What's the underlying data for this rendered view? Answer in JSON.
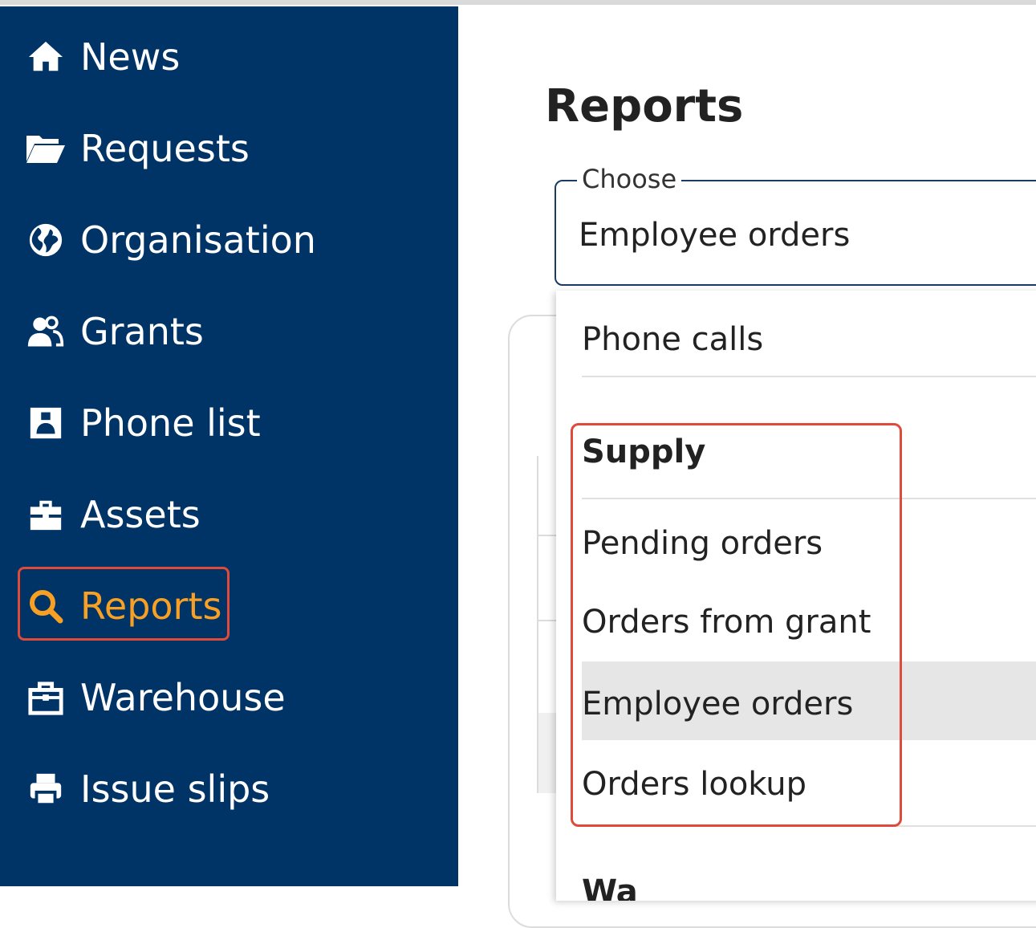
{
  "sidebar": {
    "items": [
      {
        "label": "News",
        "icon": "home-icon"
      },
      {
        "label": "Requests",
        "icon": "folder-open-icon"
      },
      {
        "label": "Organisation",
        "icon": "globe-icon"
      },
      {
        "label": "Grants",
        "icon": "users-icon"
      },
      {
        "label": "Phone list",
        "icon": "contact-card-icon"
      },
      {
        "label": "Assets",
        "icon": "briefcase-icon"
      },
      {
        "label": "Reports",
        "icon": "search-icon",
        "active": true
      },
      {
        "label": "Warehouse",
        "icon": "warehouse-icon"
      },
      {
        "label": "Issue slips",
        "icon": "printer-icon"
      }
    ],
    "background": "#003366",
    "active_color": "#f7a024"
  },
  "main": {
    "title": "Reports",
    "select": {
      "legend": "Choose",
      "value": "Employee orders"
    },
    "dropdown": {
      "options_top": [
        "Phone calls"
      ],
      "group_supply": {
        "header": "Supply",
        "options": [
          "Pending orders",
          "Orders from grant",
          "Employee orders",
          "Orders lookup"
        ],
        "highlighted": "Employee orders"
      },
      "next_group_partial": "Wa"
    }
  },
  "colors": {
    "highlight_box": "#e04a3a",
    "selected_row": "#e6e6e6"
  }
}
